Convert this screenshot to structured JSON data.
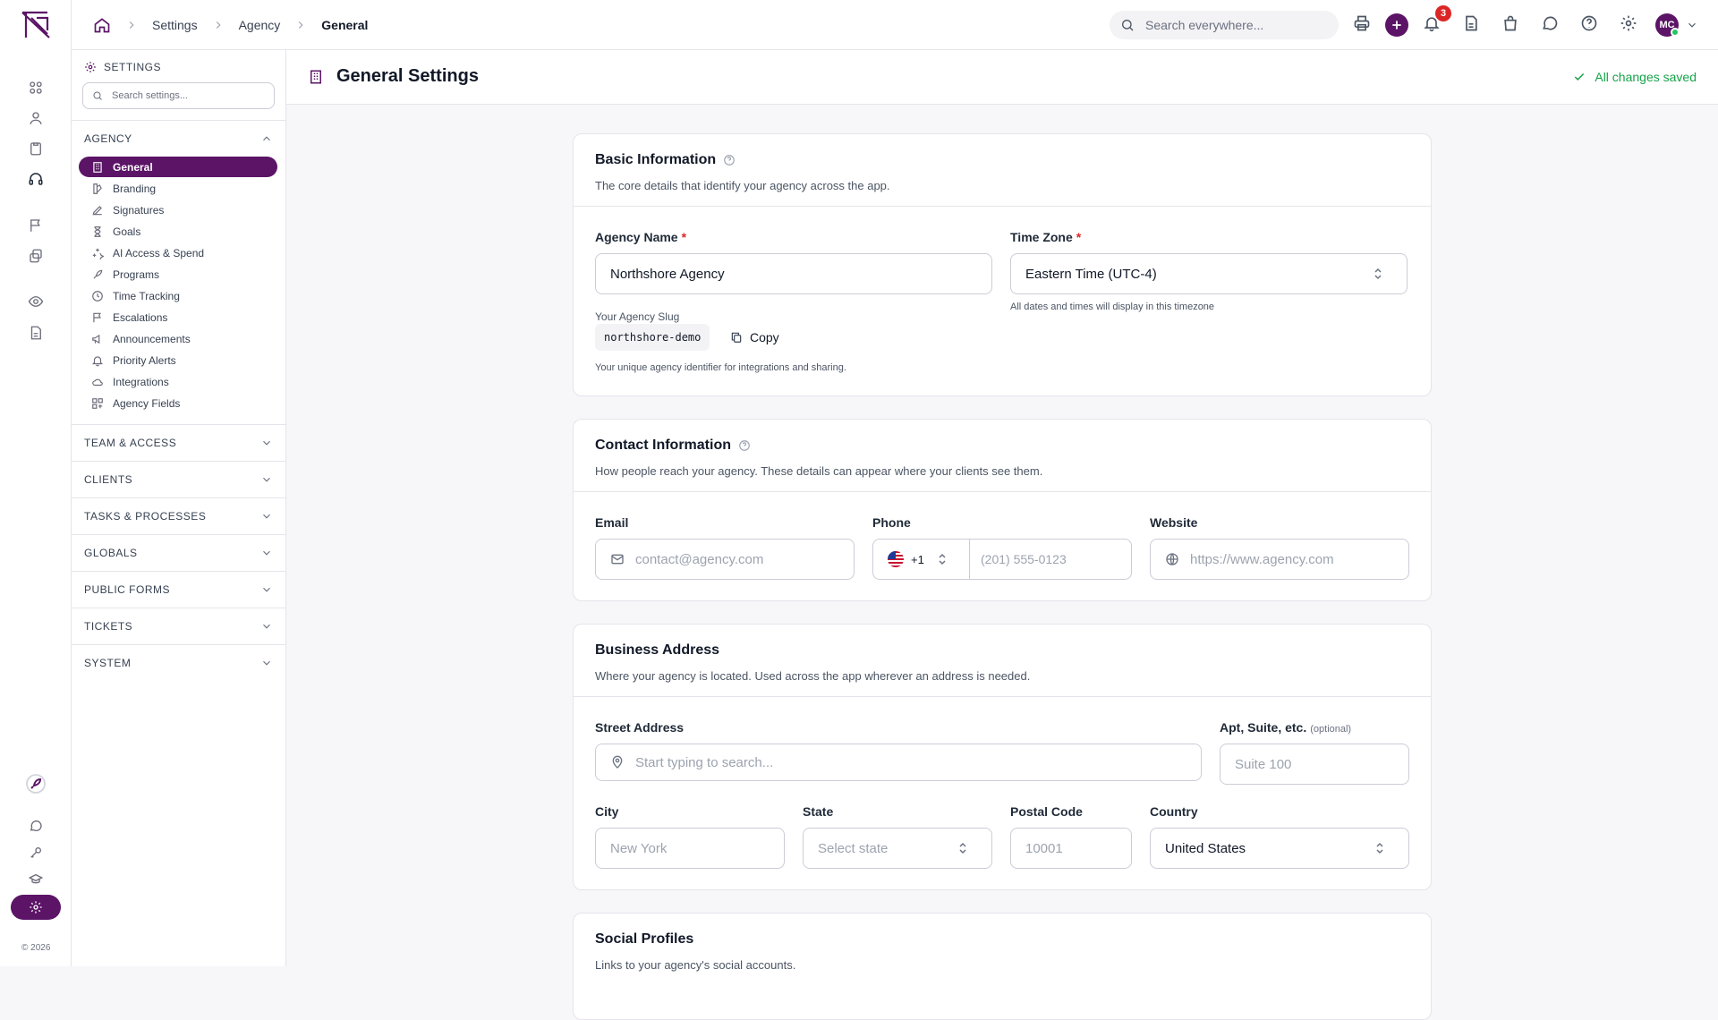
{
  "rail": {
    "copyright": "© 2026",
    "icons": [
      "apps-icon",
      "user-icon",
      "clipboard-icon",
      "headset-icon",
      "flag-icon",
      "layers-icon",
      "eye-icon",
      "document-icon",
      "rocket-icon",
      "chat-icon",
      "key-icon",
      "graduation-cap-icon",
      "settings-icon"
    ]
  },
  "topbar": {
    "breadcrumb": [
      "Settings",
      "Agency",
      "General"
    ],
    "search_placeholder": "Search everywhere...",
    "notification_count": "3",
    "avatar_initials": "MC"
  },
  "sidebar": {
    "title": "SETTINGS",
    "search_placeholder": "Search settings...",
    "agency_group": "AGENCY",
    "items": [
      {
        "label": "General",
        "icon": "building-icon",
        "active": true
      },
      {
        "label": "Branding",
        "icon": "palette-icon"
      },
      {
        "label": "Signatures",
        "icon": "pen-icon"
      },
      {
        "label": "Goals",
        "icon": "hourglass-icon"
      },
      {
        "label": "AI Access & Spend",
        "icon": "sparkles-icon"
      },
      {
        "label": "Programs",
        "icon": "rocket-icon"
      },
      {
        "label": "Time Tracking",
        "icon": "clock-icon"
      },
      {
        "label": "Escalations",
        "icon": "flag-icon"
      },
      {
        "label": "Announcements",
        "icon": "megaphone-icon"
      },
      {
        "label": "Priority Alerts",
        "icon": "bell-icon"
      },
      {
        "label": "Integrations",
        "icon": "cloud-icon"
      },
      {
        "label": "Agency Fields",
        "icon": "fields-icon"
      }
    ],
    "groups": [
      "TEAM & ACCESS",
      "CLIENTS",
      "TASKS & PROCESSES",
      "GLOBALS",
      "PUBLIC FORMS",
      "TICKETS",
      "SYSTEM"
    ]
  },
  "main": {
    "title": "General Settings",
    "saved_status": "All changes saved"
  },
  "basic": {
    "title": "Basic Information",
    "subtitle": "The core details that identify your agency across the app.",
    "agency_name_label": "Agency Name",
    "agency_name_value": "Northshore Agency",
    "timezone_label": "Time Zone",
    "timezone_value": "Eastern Time (UTC-4)",
    "timezone_help": "All dates and times will display in this timezone",
    "slug_label": "Your Agency Slug",
    "slug_value": "northshore-demo",
    "copy_label": "Copy",
    "slug_help": "Your unique agency identifier for integrations and sharing.",
    "required_mark": "*"
  },
  "contact": {
    "title": "Contact Information",
    "subtitle": "How people reach your agency. These details can appear where your clients see them.",
    "email_label": "Email",
    "email_placeholder": "contact@agency.com",
    "phone_label": "Phone",
    "country_code": "+1",
    "phone_placeholder": "(201) 555-0123",
    "website_label": "Website",
    "website_placeholder": "https://www.agency.com"
  },
  "address": {
    "title": "Business Address",
    "subtitle": "Where your agency is located. Used across the app wherever an address is needed.",
    "street_label": "Street Address",
    "street_placeholder": "Start typing to search...",
    "apt_label": "Apt, Suite, etc.",
    "apt_optional": "(optional)",
    "apt_placeholder": "Suite 100",
    "city_label": "City",
    "city_placeholder": "New York",
    "state_label": "State",
    "state_placeholder": "Select state",
    "postal_label": "Postal Code",
    "postal_placeholder": "10001",
    "country_label": "Country",
    "country_value": "United States"
  },
  "social": {
    "title": "Social Profiles",
    "subtitle": "Links to your agency's social accounts."
  },
  "colors": {
    "brand": "#5b1466",
    "success": "#16a34a",
    "danger": "#dc2626"
  }
}
